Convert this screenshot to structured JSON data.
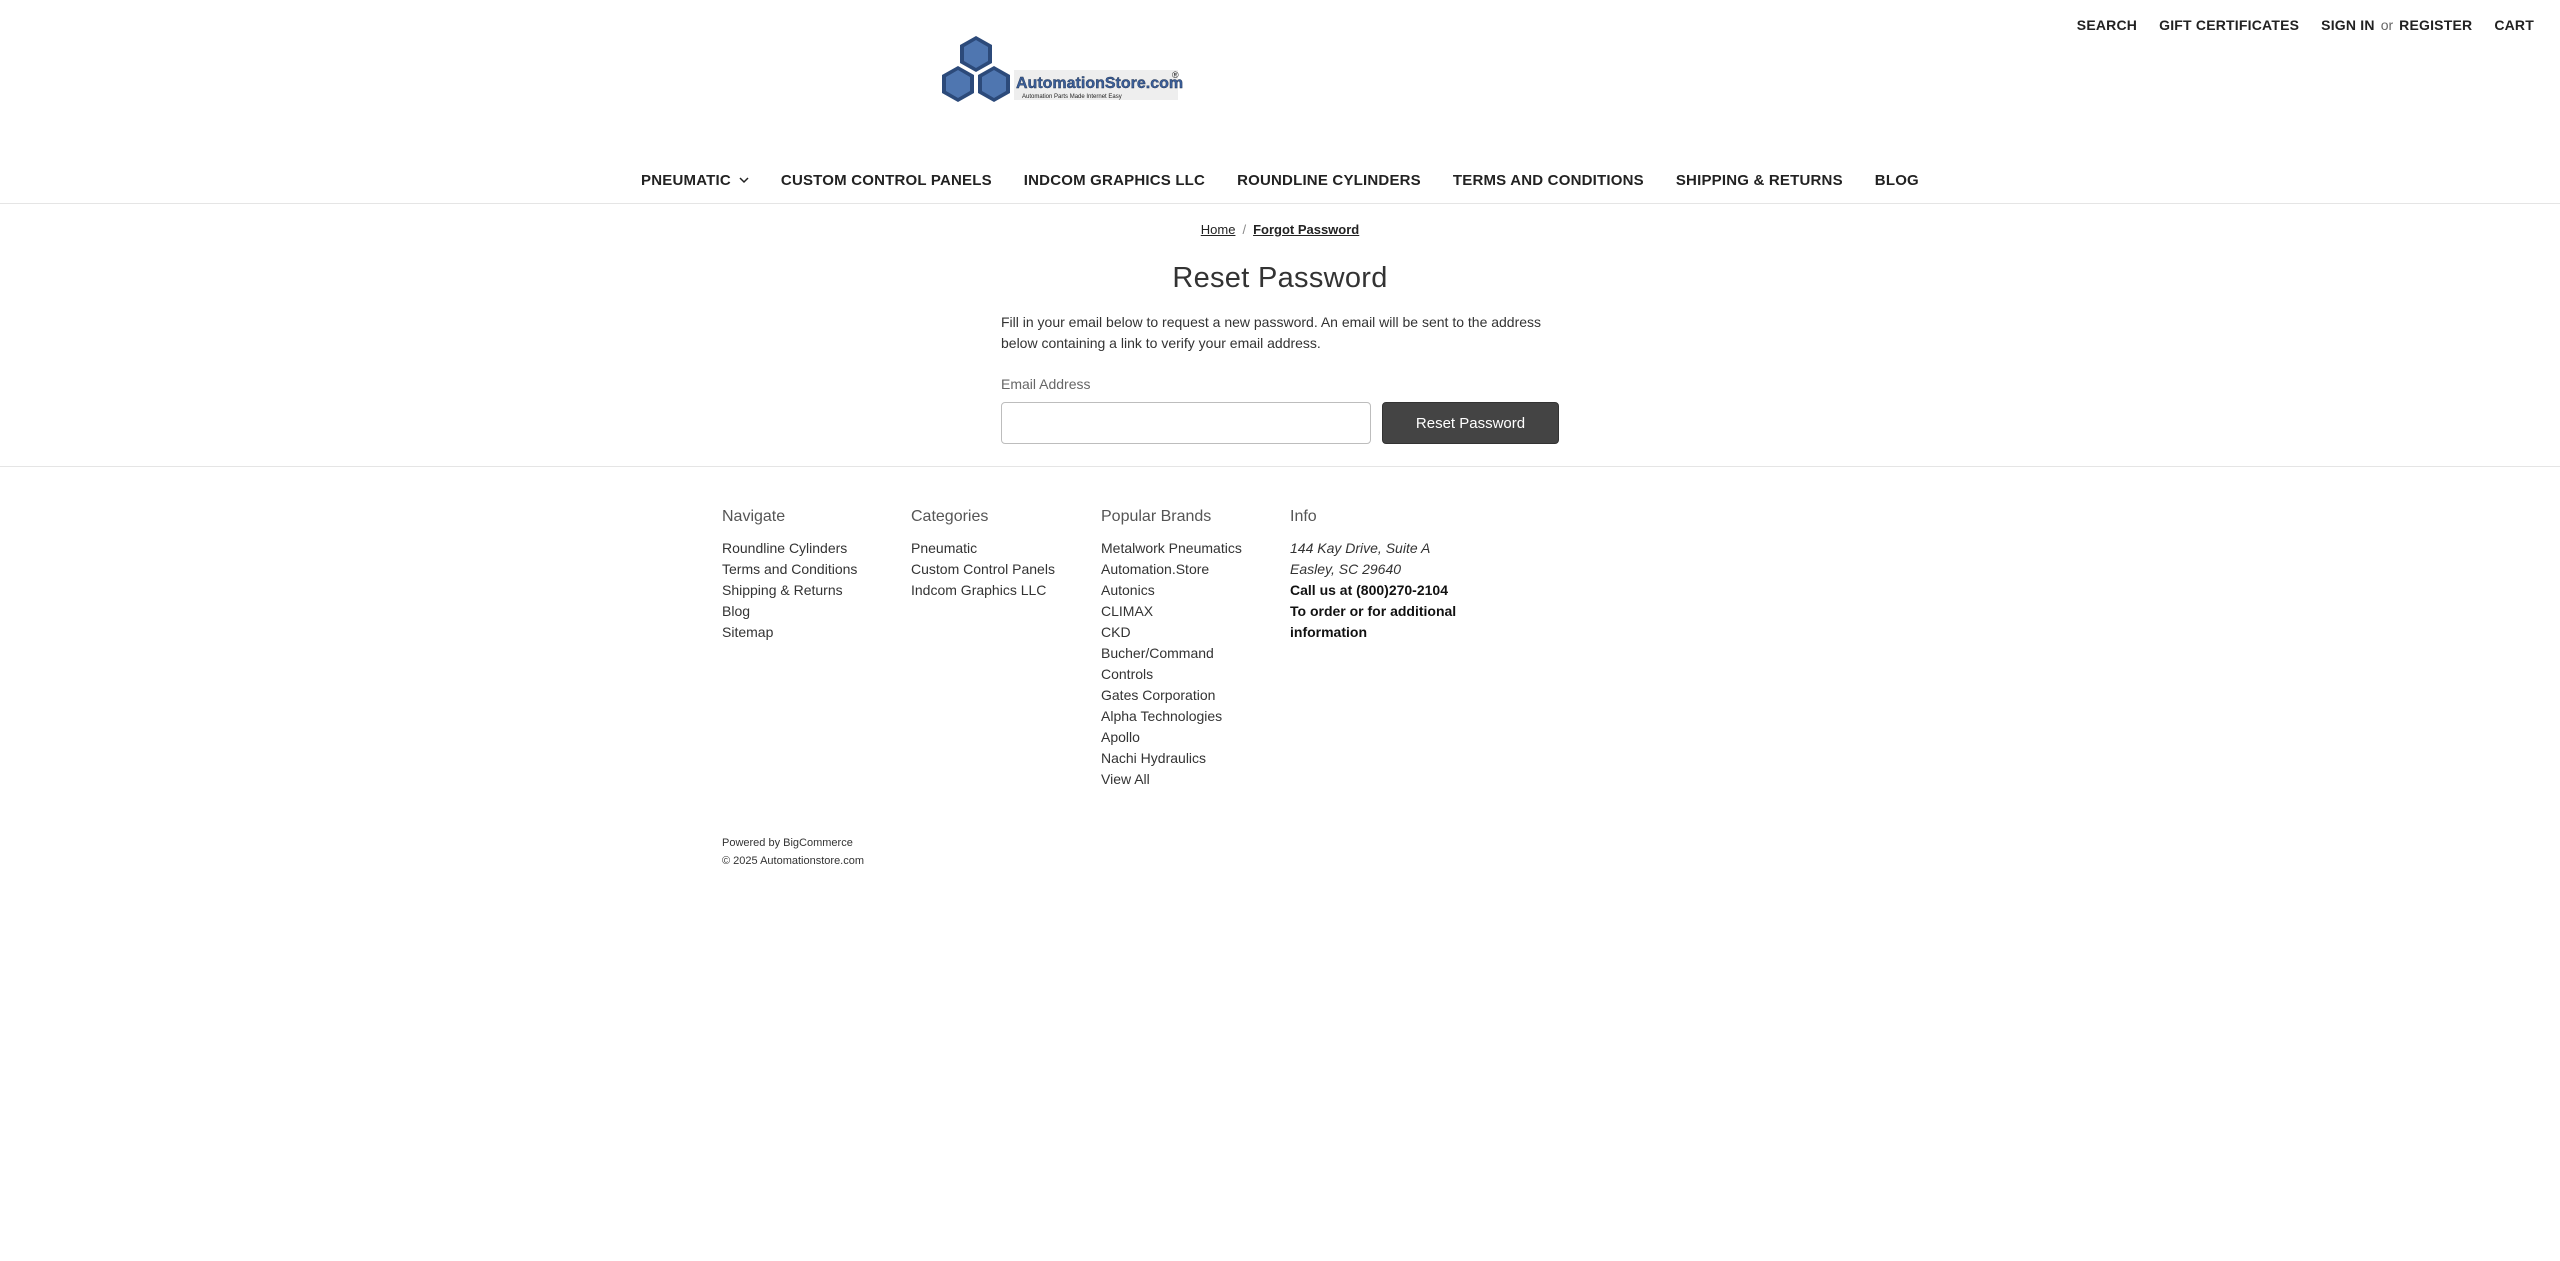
{
  "utility_nav": {
    "search": "SEARCH",
    "gift_certificates": "GIFT CERTIFICATES",
    "sign_in": "SIGN IN",
    "or": "or",
    "register": "REGISTER",
    "cart": "CART"
  },
  "logo": {
    "text": "AutomationStore.com",
    "tagline": "Automation Parts Made Internet Easy",
    "registered": "®"
  },
  "main_nav": {
    "items": [
      {
        "label": "PNEUMATIC",
        "has_dropdown": true
      },
      {
        "label": "CUSTOM CONTROL PANELS"
      },
      {
        "label": "INDCOM GRAPHICS LLC"
      },
      {
        "label": "ROUNDLINE CYLINDERS"
      },
      {
        "label": "TERMS AND CONDITIONS"
      },
      {
        "label": "SHIPPING & RETURNS"
      },
      {
        "label": "BLOG"
      }
    ]
  },
  "breadcrumb": {
    "home": "Home",
    "separator": "/",
    "current": "Forgot Password"
  },
  "page": {
    "title": "Reset Password",
    "intro": "Fill in your email below to request a new password. An email will be sent to the address below containing a link to verify your email address.",
    "email_label": "Email Address",
    "email_value": "",
    "submit_label": "Reset Password"
  },
  "footer": {
    "navigate": {
      "heading": "Navigate",
      "items": [
        "Roundline Cylinders",
        "Terms and Conditions",
        "Shipping & Returns",
        "Blog",
        "Sitemap"
      ]
    },
    "categories": {
      "heading": "Categories",
      "items": [
        "Pneumatic",
        "Custom Control Panels",
        "Indcom Graphics LLC"
      ]
    },
    "brands": {
      "heading": "Popular Brands",
      "items": [
        "Metalwork Pneumatics",
        "Automation.Store",
        "Autonics",
        "CLIMAX",
        "CKD",
        "Bucher/Command Controls",
        "Gates Corporation",
        "Alpha Technologies",
        "Apollo",
        "Nachi Hydraulics",
        "View All"
      ]
    },
    "info": {
      "heading": "Info",
      "address_line1": "144 Kay Drive, Suite A",
      "address_line2": "Easley, SC 29640",
      "phone": "Call us at (800)270-2104",
      "note": "To order or for additional information"
    },
    "powered_by": "Powered by BigCommerce",
    "copyright": "© 2025 Automationstore.com"
  },
  "colors": {
    "button_bg": "#444444",
    "logo_blue": "#3b5f9a",
    "divider": "#e5e5e5"
  }
}
